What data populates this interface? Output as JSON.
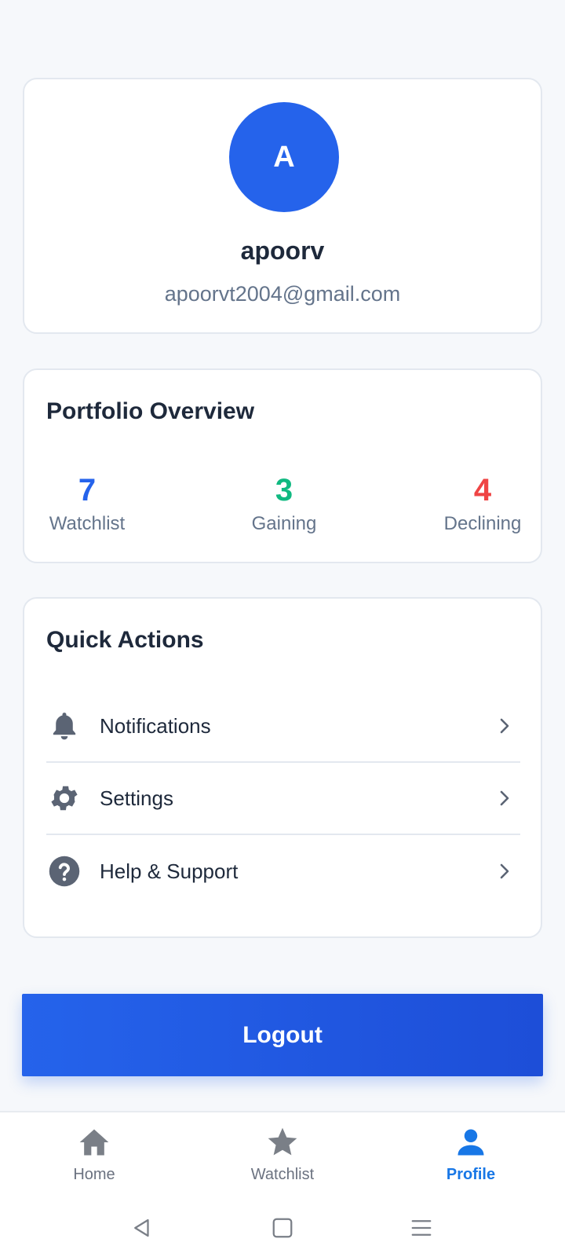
{
  "profile": {
    "avatar_initial": "A",
    "name": "apoorv",
    "email": "apoorvt2004@gmail.com",
    "avatar_color": "#2563eb"
  },
  "portfolio": {
    "title": "Portfolio Overview",
    "stats": [
      {
        "value": "7",
        "label": "Watchlist",
        "color": "#2563eb"
      },
      {
        "value": "3",
        "label": "Gaining",
        "color": "#10b981"
      },
      {
        "value": "4",
        "label": "Declining",
        "color": "#ef4444"
      }
    ]
  },
  "quick_actions": {
    "title": "Quick Actions",
    "items": [
      {
        "label": "Notifications",
        "icon": "bell-icon"
      },
      {
        "label": "Settings",
        "icon": "gear-icon"
      },
      {
        "label": "Help & Support",
        "icon": "help-circle-icon"
      }
    ]
  },
  "logout": {
    "label": "Logout"
  },
  "bottom_nav": {
    "items": [
      {
        "label": "Home",
        "icon": "home-icon",
        "active": false
      },
      {
        "label": "Watchlist",
        "icon": "star-icon",
        "active": false
      },
      {
        "label": "Profile",
        "icon": "person-icon",
        "active": true
      }
    ],
    "active_color": "#1877e6"
  },
  "system_nav": {
    "buttons": [
      "back-icon",
      "home-square-icon",
      "menu-icon"
    ]
  }
}
